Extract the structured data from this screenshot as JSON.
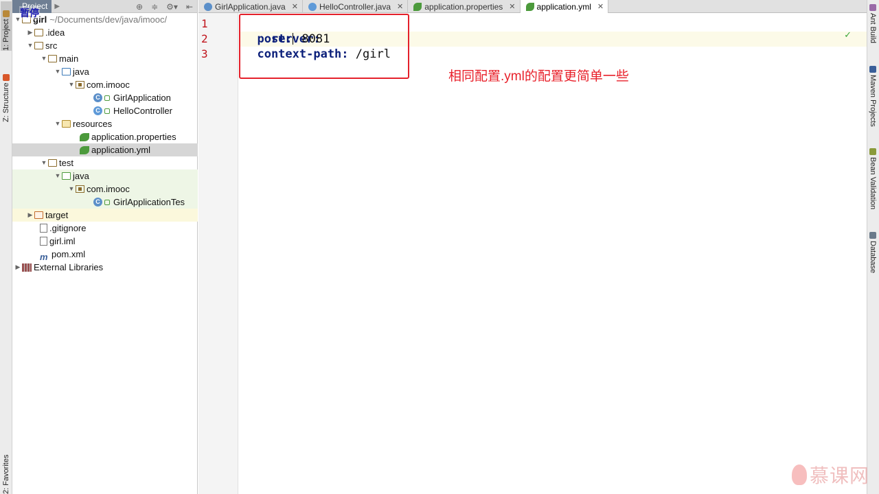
{
  "left_strip": {
    "tabs": [
      {
        "label": "1: Project",
        "icon": "project-icon"
      },
      {
        "label": "Z: Structure",
        "icon": "structure-icon"
      },
      {
        "label": "2: Favorites",
        "icon": "favorites-icon"
      }
    ]
  },
  "right_strip": {
    "tabs": [
      {
        "label": "Ant Build",
        "icon": "ant-icon"
      },
      {
        "label": "Maven Projects",
        "icon": "maven-icon"
      },
      {
        "label": "Bean Validation",
        "icon": "bean-icon"
      },
      {
        "label": "Database",
        "icon": "database-icon"
      }
    ]
  },
  "project_panel": {
    "title": "Project",
    "pause_label": "暂停"
  },
  "tree": {
    "root": {
      "name": "girl",
      "path": "~/Documents/dev/java/imooc/"
    },
    "items": [
      ".idea",
      "src",
      "main",
      "java",
      "com.imooc",
      "GirlApplication",
      "HelloController",
      "resources",
      "application.properties",
      "application.yml",
      "test",
      "java",
      "com.imooc",
      "GirlApplicationTes",
      "target",
      ".gitignore",
      "girl.iml",
      "pom.xml",
      "External Libraries"
    ]
  },
  "tabs": [
    {
      "label": "GirlApplication.java",
      "active": false
    },
    {
      "label": "HelloController.java",
      "active": false
    },
    {
      "label": "application.properties",
      "active": false
    },
    {
      "label": "application.yml",
      "active": true
    }
  ],
  "editor": {
    "line_numbers": [
      "1",
      "2",
      "3"
    ],
    "lines": [
      {
        "key": "server:",
        "value": ""
      },
      {
        "key": "  port:",
        "value": " 8081"
      },
      {
        "key": "  context-path:",
        "value": " /girl"
      }
    ]
  },
  "annotation": "相同配置.yml的配置更简单一些",
  "watermark": "慕课网",
  "colors": {
    "annotation_red": "#e4202a",
    "yaml_key": "#0b1f7a",
    "line_number": "#c0141c"
  }
}
